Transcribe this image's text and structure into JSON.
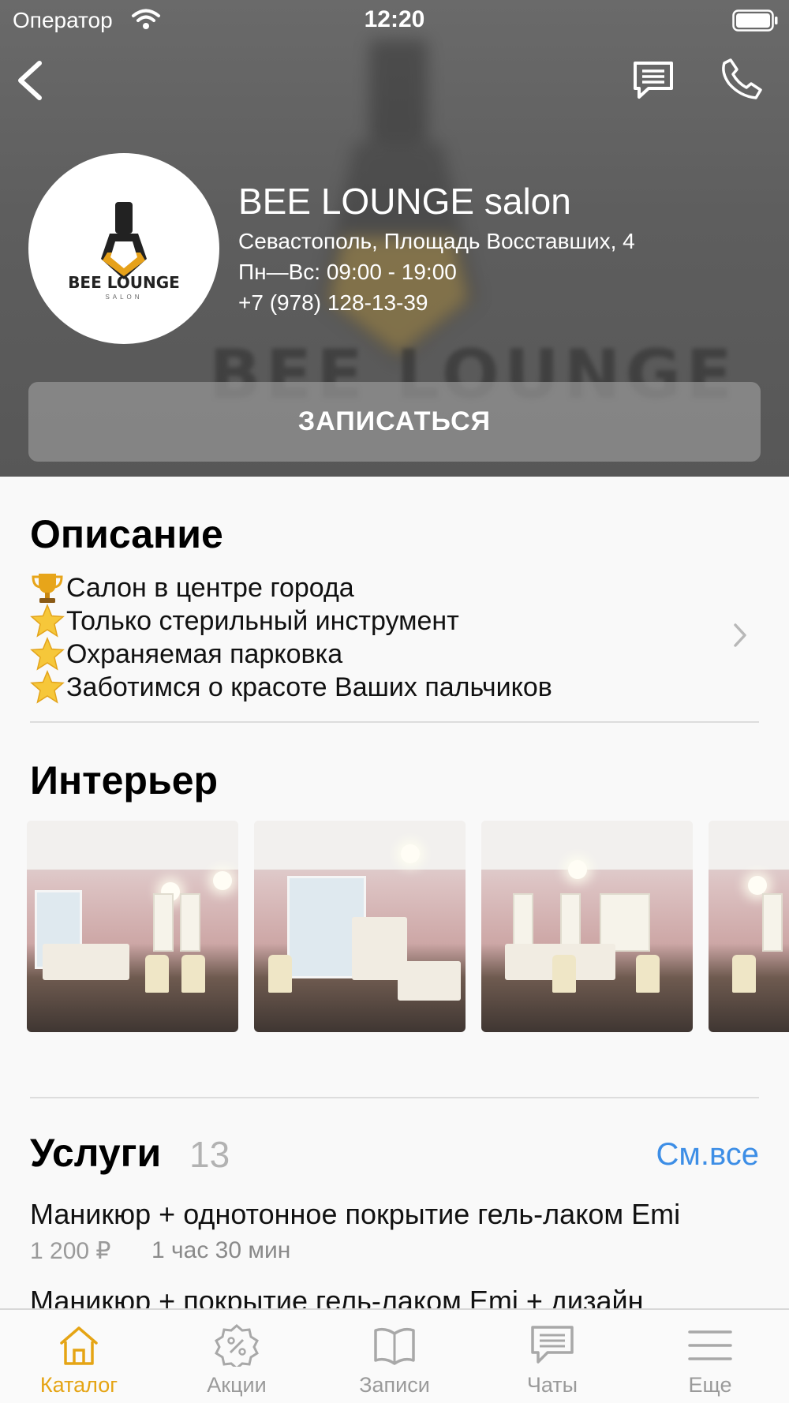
{
  "status_bar": {
    "carrier": "Оператор",
    "time": "12:20"
  },
  "hero": {
    "logo_brand": "BEE LOUNGE",
    "logo_sub": "SALON",
    "background_text": "BEE LOUNGE",
    "salon_name": "BEE LOUNGE salon",
    "address": "Севастополь, Площадь Восставших, 4",
    "hours": "Пн—Вс: 09:00 - 19:00",
    "phone": "+7 (978) 128-13-39",
    "book_button": "ЗАПИСАТЬСЯ"
  },
  "description": {
    "title": "Описание",
    "lines": [
      {
        "icon": "trophy-emoji",
        "text": "Салон в центре города"
      },
      {
        "icon": "star-emoji",
        "text": "Только стерильный инструмент"
      },
      {
        "icon": "star-emoji",
        "text": "Охраняемая парковка"
      },
      {
        "icon": "star-emoji",
        "text": "Заботимся о красоте Ваших пальчиков"
      }
    ]
  },
  "interior": {
    "title": "Интерьер"
  },
  "services": {
    "title": "Услуги",
    "count": "13",
    "see_all": "См.все",
    "items": [
      {
        "name": "Маникюр + однотонное покрытие гель-лаком Emi",
        "price": "1 200 ₽",
        "duration": "1 час 30 мин"
      },
      {
        "name": "Маникюр + покрытие гель-лаком Emi + дизайн"
      }
    ]
  },
  "tabs": [
    {
      "label": "Каталог",
      "icon": "home-icon",
      "active": true
    },
    {
      "label": "Акции",
      "icon": "percent-badge-icon",
      "active": false
    },
    {
      "label": "Записи",
      "icon": "book-icon",
      "active": false
    },
    {
      "label": "Чаты",
      "icon": "chat-icon",
      "active": false
    },
    {
      "label": "Еще",
      "icon": "menu-icon",
      "active": false
    }
  ],
  "colors": {
    "accent": "#e5a414",
    "link": "#3d8ee6",
    "inactive_tab": "#9a9a9a"
  }
}
